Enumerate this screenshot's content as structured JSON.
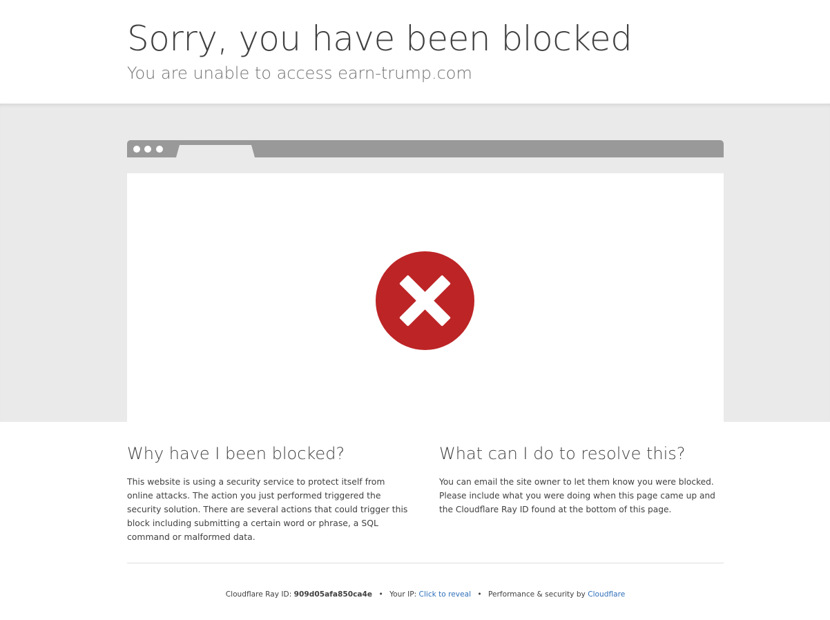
{
  "header": {
    "title": "Sorry, you have been blocked",
    "subtitle": "You are unable to access earn-trump.com"
  },
  "illustration": {
    "icon": "error-x-icon",
    "icon_color": "#bd2426",
    "window_bar_color": "#999999"
  },
  "sections": {
    "why": {
      "heading": "Why have I been blocked?",
      "body": "This website is using a security service to protect itself from online attacks. The action you just performed triggered the security solution. There are several actions that could trigger this block including submitting a certain word or phrase, a SQL command or malformed data."
    },
    "resolve": {
      "heading": "What can I do to resolve this?",
      "body": "You can email the site owner to let them know you were blocked. Please include what you were doing when this page came up and the Cloudflare Ray ID found at the bottom of this page."
    }
  },
  "footer": {
    "ray_label": "Cloudflare Ray ID: ",
    "ray_id": "909d05afa850ca4e",
    "separator": "•",
    "ip_label": "Your IP: ",
    "ip_link": "Click to reveal",
    "perf_label": "Performance & security by ",
    "cloudflare_link": "Cloudflare",
    "link_color": "#2f6fba"
  }
}
